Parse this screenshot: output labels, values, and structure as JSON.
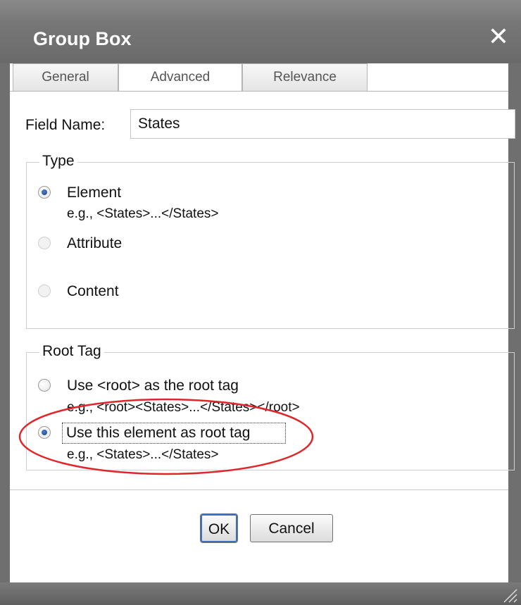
{
  "dialog": {
    "title": "Group Box",
    "close_symbol": "✕"
  },
  "tabs": [
    {
      "label": "General"
    },
    {
      "label": "Advanced"
    },
    {
      "label": "Relevance"
    }
  ],
  "field_name": {
    "label": "Field Name:",
    "value": "States"
  },
  "type_group": {
    "legend": "Type",
    "options": [
      {
        "label": "Element",
        "hint": "e.g., <States>...</States>",
        "checked": true,
        "enabled": true
      },
      {
        "label": "Attribute",
        "hint": "",
        "checked": false,
        "enabled": false
      },
      {
        "label": "Content",
        "hint": "",
        "checked": false,
        "enabled": false
      }
    ]
  },
  "root_tag_group": {
    "legend": "Root Tag",
    "options": [
      {
        "label": "Use <root> as the root tag",
        "hint": "e.g., <root><States>...</States></root>",
        "checked": false
      },
      {
        "label": "Use this element as root tag",
        "hint": "e.g., <States>...</States>",
        "checked": true
      }
    ]
  },
  "buttons": {
    "ok": "OK",
    "cancel": "Cancel"
  },
  "annotation": {
    "color": "#e0262a",
    "shape": "ellipse highlight"
  },
  "colors": {
    "titlebar": "#777777",
    "radio_checked": "#1d3e86"
  },
  "icons": {
    "close": "close-icon",
    "resize": "resize-grip-icon"
  }
}
